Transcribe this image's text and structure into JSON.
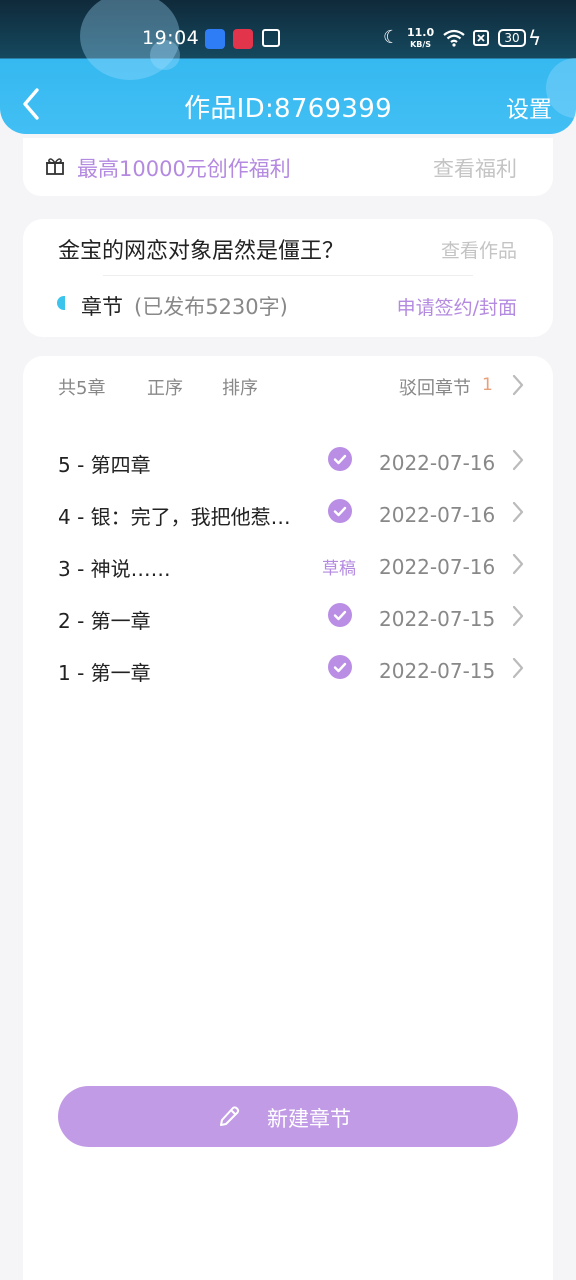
{
  "status_bar": {
    "time": "19:04",
    "net_speed_value": "11.0",
    "net_speed_unit": "KB/S",
    "battery": "30",
    "icons": [
      "android-icon",
      "screen-record-icon",
      "folder-icon",
      "moon-icon",
      "wifi-icon",
      "no-sim-icon",
      "battery-icon",
      "charging-icon"
    ]
  },
  "nav": {
    "title": "作品ID:8769399",
    "settings_label": "设置",
    "back_icon": "chevron-left-icon"
  },
  "welfare": {
    "text": "最高10000元创作福利",
    "link": "查看福利",
    "icon": "gift-icon"
  },
  "work": {
    "title": "金宝的网恋对象居然是僵王？",
    "view_link": "查看作品",
    "chapter_label": "章节",
    "chapter_count": "(已发布5230字)",
    "sign_link": "申请签约/封面"
  },
  "list": {
    "toolbar": {
      "total": "共5章",
      "order": "正序",
      "sort": "排序",
      "rejected": "驳回章节",
      "rejected_count": "1"
    },
    "chapters": [
      {
        "title": "5 - 第四章",
        "status": "published",
        "date": "2022-07-16"
      },
      {
        "title": "4 - 银：完了，我把他惹…",
        "status": "published",
        "date": "2022-07-16"
      },
      {
        "title": "3 - 神说……",
        "status": "draft",
        "status_label": "草稿",
        "date": "2022-07-16"
      },
      {
        "title": "2 - 第一章",
        "status": "published",
        "date": "2022-07-15"
      },
      {
        "title": "1 - 第一章",
        "status": "published",
        "date": "2022-07-15"
      }
    ]
  },
  "new_chapter_button": {
    "label": "新建章节",
    "icon": "pencil-icon"
  },
  "colors": {
    "accent_purple": "#b48ae0",
    "button_purple": "#c29be6",
    "header_blue": "#42bff4",
    "marker_cyan": "#3cc4ec"
  }
}
